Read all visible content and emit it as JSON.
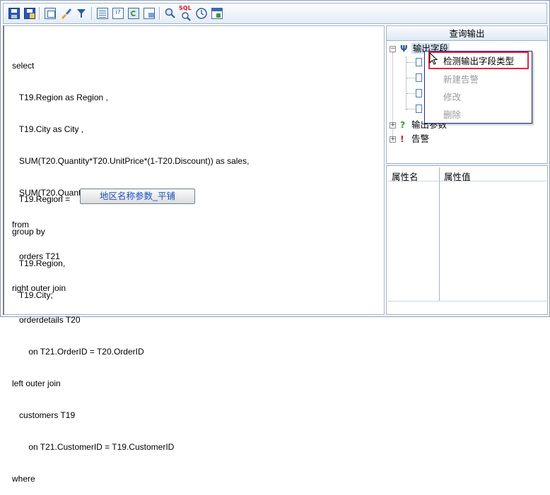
{
  "toolbar": {
    "icons": [
      "save-icon",
      "save-as-icon",
      "copy-window-icon",
      "brush-icon",
      "filter-icon",
      "list-icon",
      "info-icon",
      "refresh-icon",
      "export-icon",
      "search-icon",
      "sql-icon",
      "clock-icon",
      "calendar-icon"
    ],
    "sql_badge": "SQL"
  },
  "editor": {
    "lines_top": [
      "select",
      "   T19.Region as Region ,",
      "   T19.City as City ,",
      "   SUM(T20.Quantity*T20.UnitPrice*(1-T20.Discount)) as sales,",
      "   SUM(T20.Quantity) as Quantity",
      "from",
      "   orders T21",
      "right outer join",
      "   orderdetails T20",
      "       on T21.OrderID = T20.OrderID",
      "left outer join",
      "   customers T19",
      "       on T21.CustomerID = T19.CustomerID",
      "where"
    ],
    "region_line": "   T19.Region =",
    "param_button": "地区名称参数_平铺",
    "lines_bottom": [
      "group by",
      "   T19.Region,",
      "   T19.City;"
    ]
  },
  "right_panel": {
    "title": "查询输出",
    "tree": {
      "output_fields": "输出字段",
      "output_params": "输出参数",
      "alerts": "告警"
    },
    "props": {
      "col_name": "属性名",
      "col_value": "属性值"
    }
  },
  "context_menu": {
    "items": [
      {
        "label": "检测输出字段类型",
        "enabled": true
      },
      {
        "label": "新建告警",
        "enabled": false
      },
      {
        "label": "修改",
        "enabled": false
      },
      {
        "label": "删除",
        "enabled": false
      }
    ]
  },
  "colors": {
    "highlight": "#e0283a",
    "param_text": "#1a4fc0",
    "border": "#9fb3cd"
  }
}
